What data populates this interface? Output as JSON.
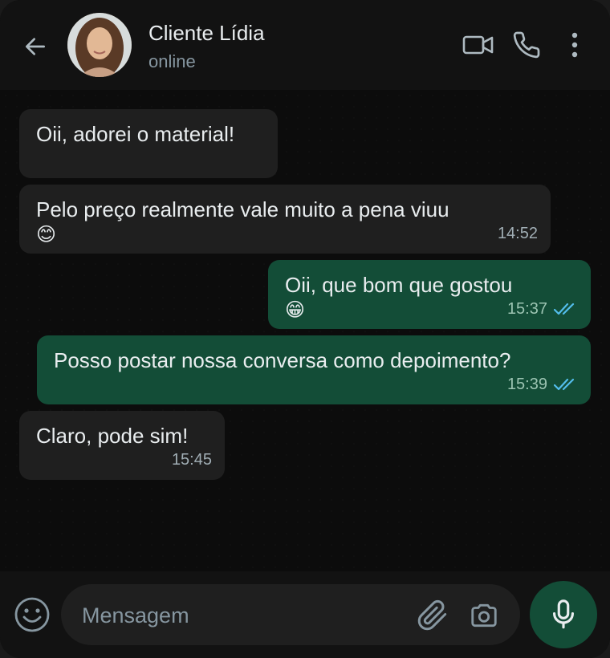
{
  "header": {
    "contact_name": "Cliente Lídia",
    "status": "online",
    "icons": [
      "back-arrow-icon",
      "video-call-icon",
      "voice-call-icon",
      "more-options-icon"
    ]
  },
  "messages": [
    {
      "direction": "incoming",
      "text": "Oii, adorei o material!",
      "emoji": "",
      "time": ""
    },
    {
      "direction": "incoming",
      "text": "Pelo preço realmente vale muito a pena viuu",
      "emoji": "😊",
      "time": "14:52"
    },
    {
      "direction": "outgoing",
      "text": "Oii, que bom que gostou",
      "emoji": "😁",
      "time": "15:37",
      "read": true
    },
    {
      "direction": "outgoing",
      "text": "Posso postar nossa conversa como depoimento?",
      "emoji": "",
      "time": "15:39",
      "read": true
    },
    {
      "direction": "incoming",
      "text": "Claro, pode sim!",
      "emoji": "",
      "time": "15:45"
    }
  ],
  "composer": {
    "placeholder": "Mensagem",
    "value": "",
    "icons": [
      "emoji-icon",
      "attach-icon",
      "camera-icon",
      "microphone-icon"
    ]
  },
  "colors": {
    "incoming_bubble": "#1f1f1f",
    "outgoing_bubble": "#134d37",
    "read_ticks": "#53bdeb",
    "accent": "#134d37"
  }
}
